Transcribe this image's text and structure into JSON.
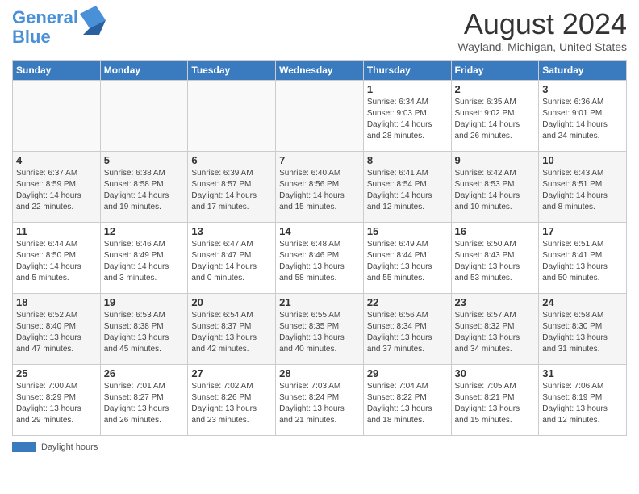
{
  "logo": {
    "line1": "General",
    "line2": "Blue"
  },
  "title": "August 2024",
  "location": "Wayland, Michigan, United States",
  "days_of_week": [
    "Sunday",
    "Monday",
    "Tuesday",
    "Wednesday",
    "Thursday",
    "Friday",
    "Saturday"
  ],
  "legend_label": "Daylight hours",
  "weeks": [
    [
      {
        "day": "",
        "info": "",
        "empty": true
      },
      {
        "day": "",
        "info": "",
        "empty": true
      },
      {
        "day": "",
        "info": "",
        "empty": true
      },
      {
        "day": "",
        "info": "",
        "empty": true
      },
      {
        "day": "1",
        "info": "Sunrise: 6:34 AM\nSunset: 9:03 PM\nDaylight: 14 hours and 28 minutes."
      },
      {
        "day": "2",
        "info": "Sunrise: 6:35 AM\nSunset: 9:02 PM\nDaylight: 14 hours and 26 minutes."
      },
      {
        "day": "3",
        "info": "Sunrise: 6:36 AM\nSunset: 9:01 PM\nDaylight: 14 hours and 24 minutes."
      }
    ],
    [
      {
        "day": "4",
        "info": "Sunrise: 6:37 AM\nSunset: 8:59 PM\nDaylight: 14 hours and 22 minutes."
      },
      {
        "day": "5",
        "info": "Sunrise: 6:38 AM\nSunset: 8:58 PM\nDaylight: 14 hours and 19 minutes."
      },
      {
        "day": "6",
        "info": "Sunrise: 6:39 AM\nSunset: 8:57 PM\nDaylight: 14 hours and 17 minutes."
      },
      {
        "day": "7",
        "info": "Sunrise: 6:40 AM\nSunset: 8:56 PM\nDaylight: 14 hours and 15 minutes."
      },
      {
        "day": "8",
        "info": "Sunrise: 6:41 AM\nSunset: 8:54 PM\nDaylight: 14 hours and 12 minutes."
      },
      {
        "day": "9",
        "info": "Sunrise: 6:42 AM\nSunset: 8:53 PM\nDaylight: 14 hours and 10 minutes."
      },
      {
        "day": "10",
        "info": "Sunrise: 6:43 AM\nSunset: 8:51 PM\nDaylight: 14 hours and 8 minutes."
      }
    ],
    [
      {
        "day": "11",
        "info": "Sunrise: 6:44 AM\nSunset: 8:50 PM\nDaylight: 14 hours and 5 minutes."
      },
      {
        "day": "12",
        "info": "Sunrise: 6:46 AM\nSunset: 8:49 PM\nDaylight: 14 hours and 3 minutes."
      },
      {
        "day": "13",
        "info": "Sunrise: 6:47 AM\nSunset: 8:47 PM\nDaylight: 14 hours and 0 minutes."
      },
      {
        "day": "14",
        "info": "Sunrise: 6:48 AM\nSunset: 8:46 PM\nDaylight: 13 hours and 58 minutes."
      },
      {
        "day": "15",
        "info": "Sunrise: 6:49 AM\nSunset: 8:44 PM\nDaylight: 13 hours and 55 minutes."
      },
      {
        "day": "16",
        "info": "Sunrise: 6:50 AM\nSunset: 8:43 PM\nDaylight: 13 hours and 53 minutes."
      },
      {
        "day": "17",
        "info": "Sunrise: 6:51 AM\nSunset: 8:41 PM\nDaylight: 13 hours and 50 minutes."
      }
    ],
    [
      {
        "day": "18",
        "info": "Sunrise: 6:52 AM\nSunset: 8:40 PM\nDaylight: 13 hours and 47 minutes."
      },
      {
        "day": "19",
        "info": "Sunrise: 6:53 AM\nSunset: 8:38 PM\nDaylight: 13 hours and 45 minutes."
      },
      {
        "day": "20",
        "info": "Sunrise: 6:54 AM\nSunset: 8:37 PM\nDaylight: 13 hours and 42 minutes."
      },
      {
        "day": "21",
        "info": "Sunrise: 6:55 AM\nSunset: 8:35 PM\nDaylight: 13 hours and 40 minutes."
      },
      {
        "day": "22",
        "info": "Sunrise: 6:56 AM\nSunset: 8:34 PM\nDaylight: 13 hours and 37 minutes."
      },
      {
        "day": "23",
        "info": "Sunrise: 6:57 AM\nSunset: 8:32 PM\nDaylight: 13 hours and 34 minutes."
      },
      {
        "day": "24",
        "info": "Sunrise: 6:58 AM\nSunset: 8:30 PM\nDaylight: 13 hours and 31 minutes."
      }
    ],
    [
      {
        "day": "25",
        "info": "Sunrise: 7:00 AM\nSunset: 8:29 PM\nDaylight: 13 hours and 29 minutes."
      },
      {
        "day": "26",
        "info": "Sunrise: 7:01 AM\nSunset: 8:27 PM\nDaylight: 13 hours and 26 minutes."
      },
      {
        "day": "27",
        "info": "Sunrise: 7:02 AM\nSunset: 8:26 PM\nDaylight: 13 hours and 23 minutes."
      },
      {
        "day": "28",
        "info": "Sunrise: 7:03 AM\nSunset: 8:24 PM\nDaylight: 13 hours and 21 minutes."
      },
      {
        "day": "29",
        "info": "Sunrise: 7:04 AM\nSunset: 8:22 PM\nDaylight: 13 hours and 18 minutes."
      },
      {
        "day": "30",
        "info": "Sunrise: 7:05 AM\nSunset: 8:21 PM\nDaylight: 13 hours and 15 minutes."
      },
      {
        "day": "31",
        "info": "Sunrise: 7:06 AM\nSunset: 8:19 PM\nDaylight: 13 hours and 12 minutes."
      }
    ]
  ]
}
